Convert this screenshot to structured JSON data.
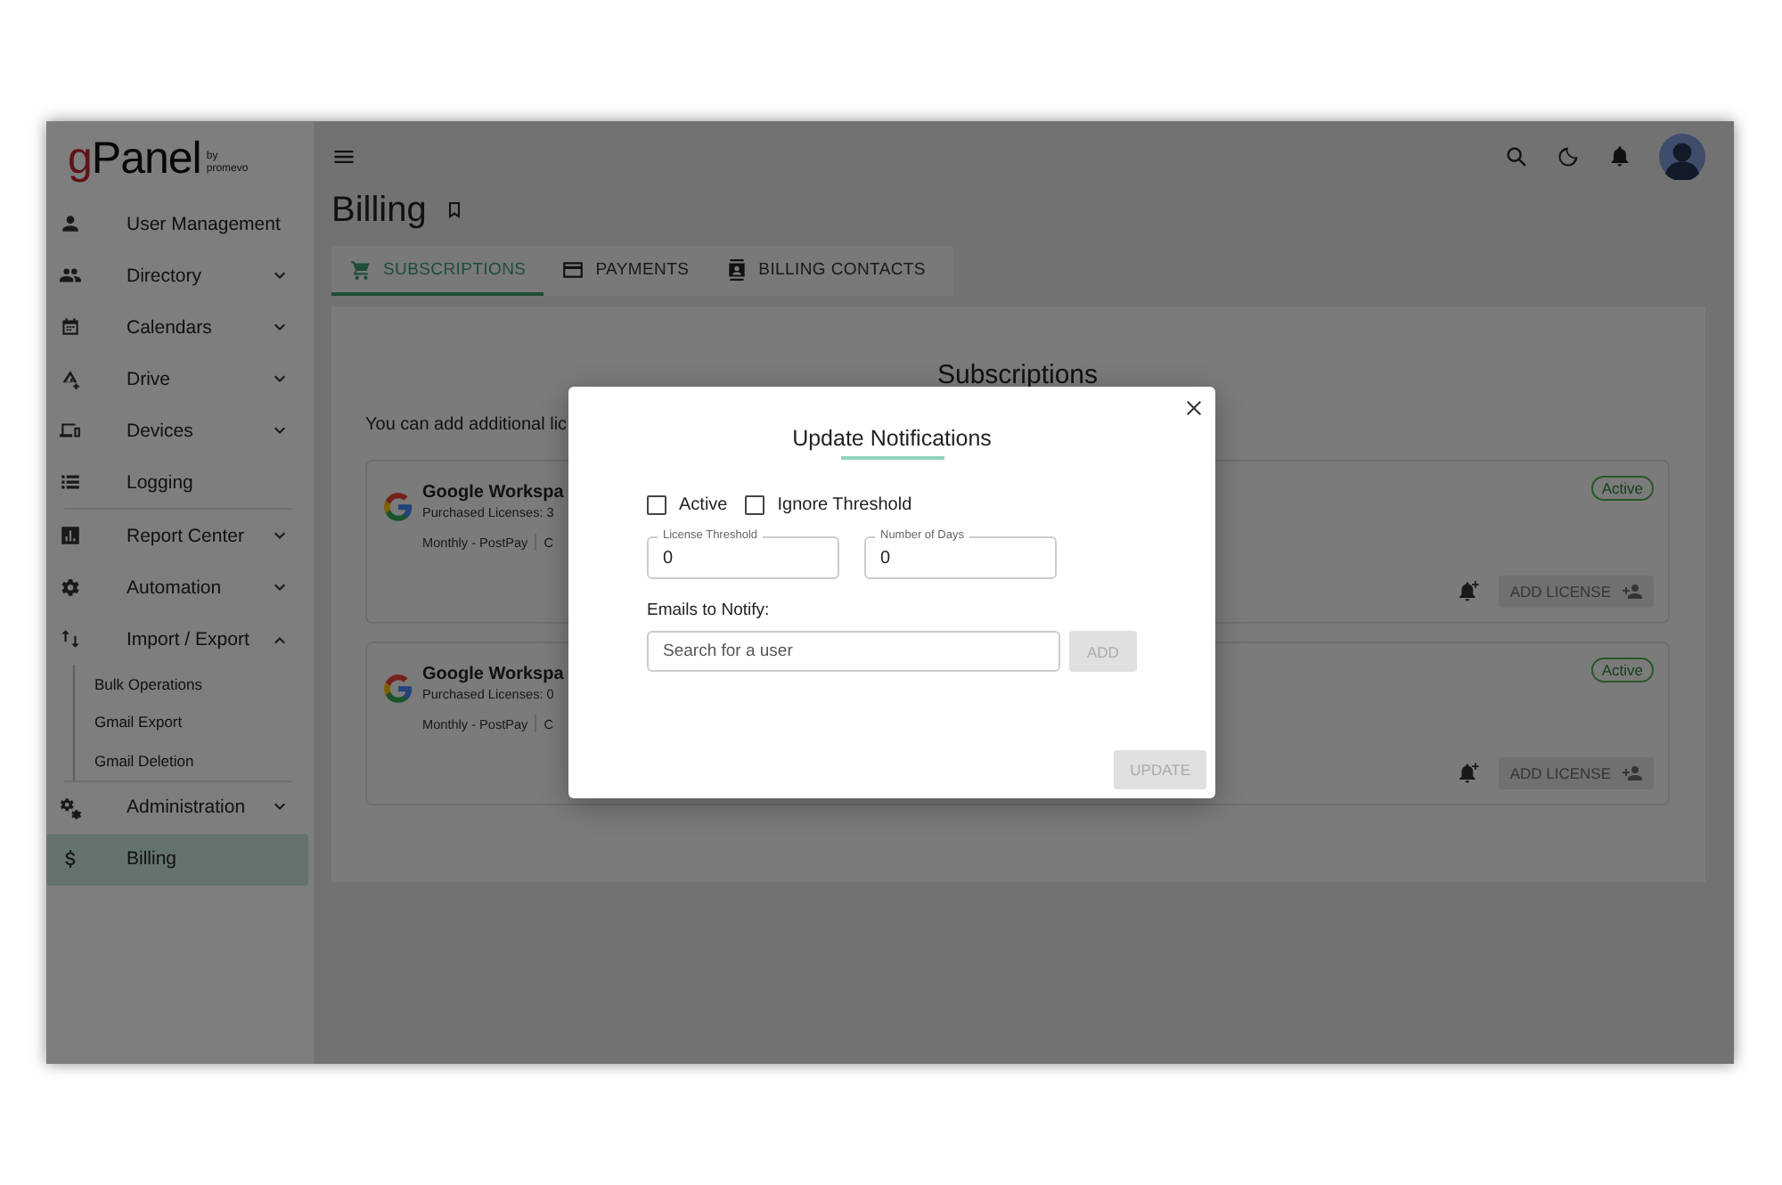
{
  "sidebar": {
    "logo": {
      "accent": "g",
      "rest": "Panel",
      "by": "by",
      "brand": "promevo"
    },
    "items": [
      {
        "label": "User Management",
        "selected": false
      },
      {
        "label": "Directory",
        "expanded": false,
        "selected": false
      },
      {
        "label": "Calendars",
        "expanded": false,
        "selected": false
      },
      {
        "label": "Drive",
        "expanded": false,
        "selected": false
      },
      {
        "label": "Devices",
        "expanded": false,
        "selected": false
      },
      {
        "label": "Logging",
        "selected": false,
        "divider_after": true
      },
      {
        "label": "Report Center",
        "expanded": false,
        "selected": false
      },
      {
        "label": "Automation",
        "expanded": false,
        "selected": false
      },
      {
        "label": "Import / Export",
        "expanded": true,
        "selected": false,
        "divider_after": true,
        "children": [
          {
            "label": "Bulk Operations"
          },
          {
            "label": "Gmail Export"
          },
          {
            "label": "Gmail Deletion"
          }
        ]
      },
      {
        "label": "Administration",
        "expanded": false,
        "selected": false
      },
      {
        "label": "Billing",
        "selected": true
      }
    ]
  },
  "page": {
    "title": "Billing",
    "tabs": [
      {
        "label": "SUBSCRIPTIONS",
        "selected": true
      },
      {
        "label": "PAYMENTS",
        "selected": false
      },
      {
        "label": "BILLING CONTACTS",
        "selected": false
      }
    ],
    "heading": "Subscriptions",
    "note": "You can add additional lic",
    "subscriptions": [
      {
        "name": "Google Workspa",
        "licenses": "Purchased Licenses: 3",
        "plan": "Monthly - PostPay",
        "column_2": "C",
        "status": "Active",
        "button": "ADD LICENSE"
      },
      {
        "name": "Google Workspa",
        "licenses": "Purchased Licenses: 0",
        "plan": "Monthly - PostPay",
        "column_2": "C",
        "status": "Active",
        "button": "ADD LICENSE"
      }
    ]
  },
  "dialog": {
    "title": "Update Notifications",
    "checkboxes": [
      {
        "label": "Active",
        "checked": false
      },
      {
        "label": "Ignore Threshold",
        "checked": false
      }
    ],
    "fields": [
      {
        "label": "License Threshold",
        "value": "0"
      },
      {
        "label": "Number of Days",
        "value": "0"
      }
    ],
    "emails_label": "Emails to Notify:",
    "search": {
      "placeholder": "Search for a user"
    },
    "add_button": {
      "label": "ADD",
      "disabled": true
    },
    "update_button": {
      "label": "UPDATE",
      "disabled": true
    }
  }
}
